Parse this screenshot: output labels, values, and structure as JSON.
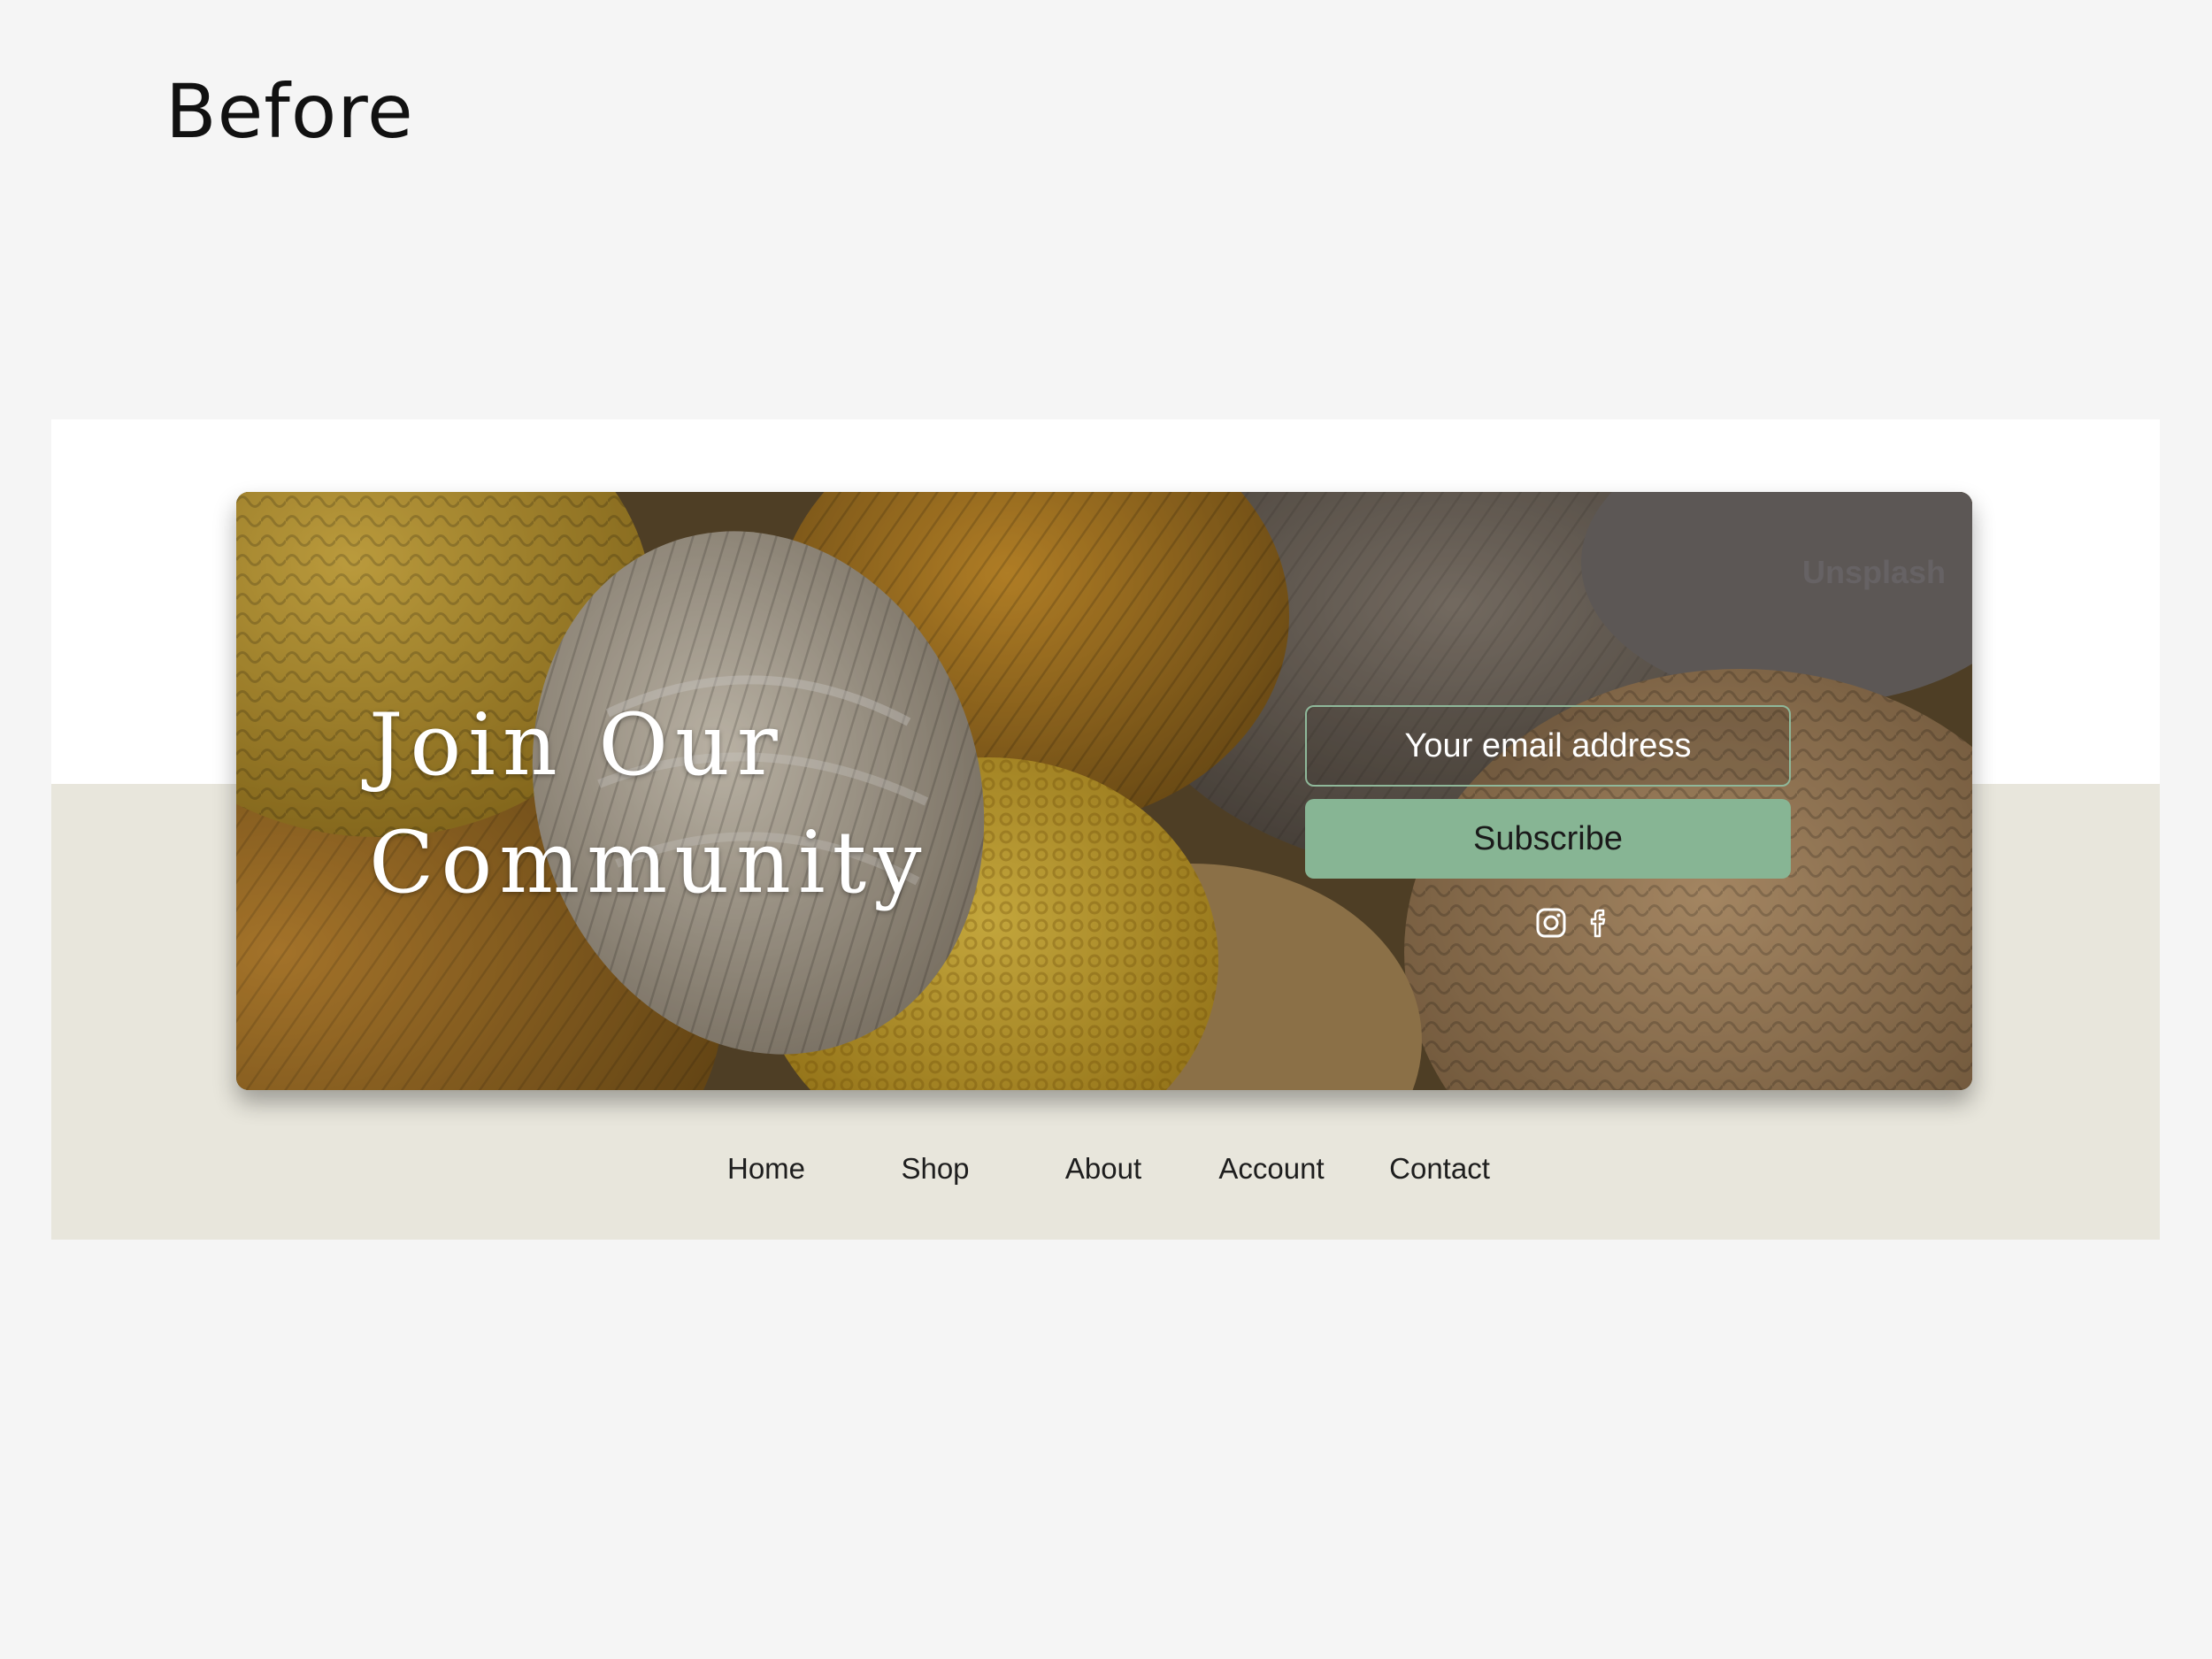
{
  "page": {
    "heading": "Before",
    "background_color": "#f5f5f5"
  },
  "mockup": {
    "footer_band_color": "#e8e6dc",
    "banner": {
      "title_line1": "Join Our",
      "title_line2": "Community",
      "image_subject": "yarn skeins",
      "photo_credit": "Unsplash",
      "email_placeholder": "Your email address",
      "subscribe_label": "Subscribe",
      "subscribe_color": "#87b594",
      "input_border_color": "#8fb89a",
      "social": [
        "instagram-icon",
        "facebook-icon"
      ]
    },
    "nav": [
      {
        "label": "Home"
      },
      {
        "label": "Shop"
      },
      {
        "label": "About"
      },
      {
        "label": "Account"
      },
      {
        "label": "Contact"
      }
    ]
  }
}
